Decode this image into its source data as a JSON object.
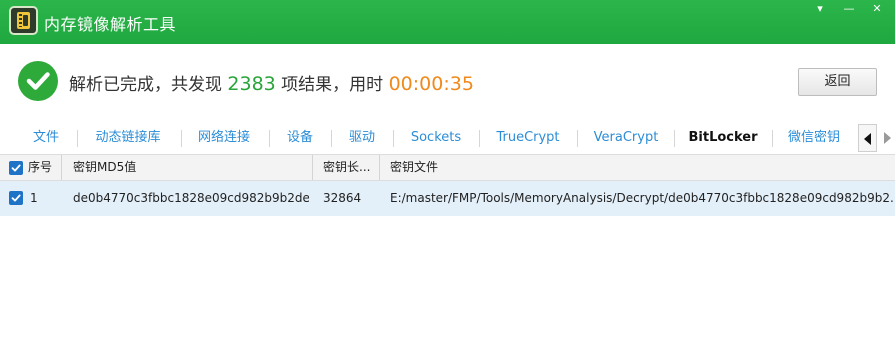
{
  "window": {
    "title": "内存镜像解析工具",
    "controls": {
      "menu": "▾",
      "minimize": "—",
      "close": "✕"
    }
  },
  "status": {
    "prefix": "解析已完成，共发现",
    "count": "2383",
    "middle": "项结果，用时",
    "elapsed": "00:00:35",
    "back_label": "返回",
    "colors": {
      "count": "#2aa43a",
      "elapsed": "#f08a1c",
      "ok": "#2eaa3a"
    }
  },
  "tabs": {
    "items": [
      {
        "label": "文件"
      },
      {
        "label": "动态链接库"
      },
      {
        "label": "网络连接"
      },
      {
        "label": "设备"
      },
      {
        "label": "驱动"
      },
      {
        "label": "Sockets"
      },
      {
        "label": "TrueCrypt"
      },
      {
        "label": "VeraCrypt"
      },
      {
        "label": "BitLocker"
      },
      {
        "label": "微信密钥"
      }
    ],
    "active": "BitLocker"
  },
  "table": {
    "headers": [
      "序号",
      "密钥MD5值",
      "密钥长...",
      "密钥文件"
    ],
    "rows": [
      {
        "checked": true,
        "index": "1",
        "md5": "de0b4770c3fbbc1828e09cd982b9b2de",
        "length": "32864",
        "file": "E:/master/FMP/Tools/MemoryAnalysis/Decrypt/de0b4770c3fbbc1828e09cd982b9b2..."
      }
    ]
  }
}
